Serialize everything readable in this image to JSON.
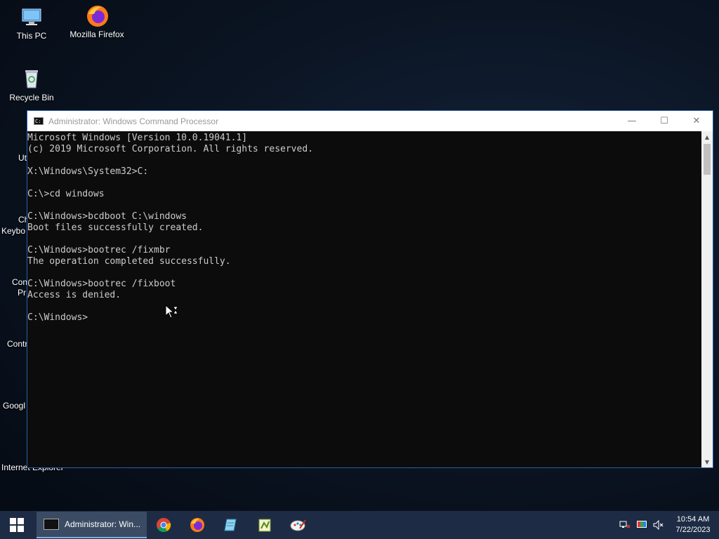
{
  "desktop": {
    "icons": [
      {
        "label": "This PC"
      },
      {
        "label": "Mozilla Firefox"
      },
      {
        "label": "Recycle Bin"
      }
    ],
    "partial_icons": [
      {
        "label": "Ut"
      },
      {
        "label": "Ch"
      },
      {
        "label": "Keybo"
      },
      {
        "label": "Conc"
      },
      {
        "label": "Pr"
      },
      {
        "label": "Contr"
      },
      {
        "label": "Googl"
      },
      {
        "label": "Internet Explorer"
      }
    ]
  },
  "window": {
    "title": "Administrator: Windows Command Processor",
    "minimize_glyph": "—",
    "maximize_glyph": "☐",
    "close_glyph": "✕"
  },
  "console": {
    "lines": [
      "Microsoft Windows [Version 10.0.19041.1]",
      "(c) 2019 Microsoft Corporation. All rights reserved.",
      "",
      "X:\\Windows\\System32>C:",
      "",
      "C:\\>cd windows",
      "",
      "C:\\Windows>bcdboot C:\\windows",
      "Boot files successfully created.",
      "",
      "C:\\Windows>bootrec /fixmbr",
      "The operation completed successfully.",
      "",
      "C:\\Windows>bootrec /fixboot",
      "Access is denied.",
      "",
      "C:\\Windows>"
    ]
  },
  "taskbar": {
    "active_app_label": "Administrator: Win...",
    "pinned": [
      "chrome-icon",
      "firefox-icon",
      "notepad-icon",
      "notepadpp-icon",
      "paint-icon"
    ],
    "clock_time": "10:54 AM",
    "clock_date": "7/22/2023"
  },
  "colors": {
    "console_bg": "#0c0c0c",
    "console_fg": "#cccccc",
    "taskbar_bg": "#1d2c44",
    "accent": "#2b5ea8"
  }
}
